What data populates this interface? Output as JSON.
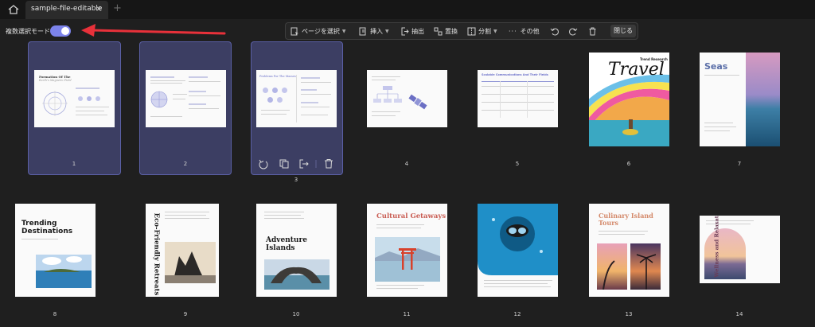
{
  "tabbar": {
    "tab_label": "sample-file-editable",
    "close_glyph": "×",
    "add_glyph": "+"
  },
  "multi_select": {
    "label": "複数選択モード",
    "enabled": true
  },
  "toolbar": {
    "select_pages": "ページを選択",
    "insert": "挿入",
    "extract": "抽出",
    "replace": "置換",
    "split": "分割",
    "more": "その他",
    "close": "閉じる"
  },
  "pages": [
    {
      "number": "1",
      "title": "Formation Of The",
      "subtitle": "Earth's Magnetic Field",
      "selected": true
    },
    {
      "number": "2",
      "selected": true
    },
    {
      "number": "3",
      "title": "Problems For The Masses",
      "selected": true
    },
    {
      "number": "4",
      "selected": false
    },
    {
      "number": "5",
      "title": "Scalable Communications And Their Fields",
      "selected": false
    },
    {
      "number": "6",
      "title": "Travel",
      "subtitle": "Trend Research",
      "selected": false
    },
    {
      "number": "7",
      "title": "Seas",
      "selected": false
    },
    {
      "number": "8",
      "title": "Trending Destinations",
      "selected": false
    },
    {
      "number": "9",
      "title": "Eco-Friendly Retreats",
      "selected": false
    },
    {
      "number": "10",
      "title": "Adventure Islands",
      "selected": false
    },
    {
      "number": "11",
      "title": "Cultural Getaways",
      "selected": false
    },
    {
      "number": "12",
      "selected": false
    },
    {
      "number": "13",
      "title": "Culinary Island Tours",
      "selected": false
    },
    {
      "number": "14",
      "title": "Wellness and Relaxation",
      "selected": false
    }
  ],
  "colors": {
    "accent": "#7c83ea",
    "selection": "#3c3e63",
    "annotation_arrow": "#e8313a"
  }
}
